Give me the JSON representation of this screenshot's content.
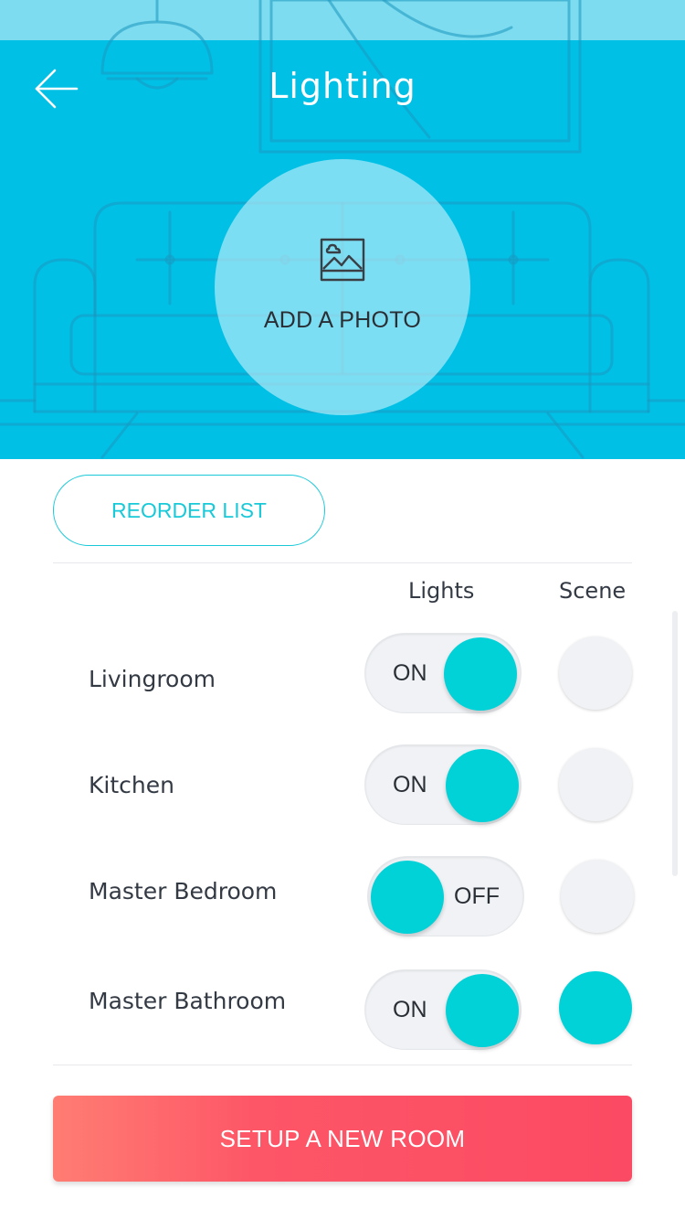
{
  "header": {
    "title": "Lighting",
    "back_icon": "arrow-left-icon",
    "photo_label": "ADD A PHOTO",
    "photo_icon": "image-icon",
    "background_color": "#00c0e6"
  },
  "actions": {
    "reorder_label": "REORDER LIST",
    "setup_label": "SETUP A NEW ROOM"
  },
  "columns": {
    "lights": "Lights",
    "scene": "Scene"
  },
  "rooms": [
    {
      "name": "Livingroom",
      "lights_state": "ON",
      "scene_active": false
    },
    {
      "name": "Kitchen",
      "lights_state": "ON",
      "scene_active": false
    },
    {
      "name": "Master Bedroom",
      "lights_state": "OFF",
      "scene_active": false
    },
    {
      "name": "Master Bathroom",
      "lights_state": "ON",
      "scene_active": true
    }
  ],
  "colors": {
    "accent": "#00d2d8",
    "outline_accent": "#19c9d8",
    "cta_start": "#ff7d73",
    "cta_end": "#fb4a63"
  }
}
